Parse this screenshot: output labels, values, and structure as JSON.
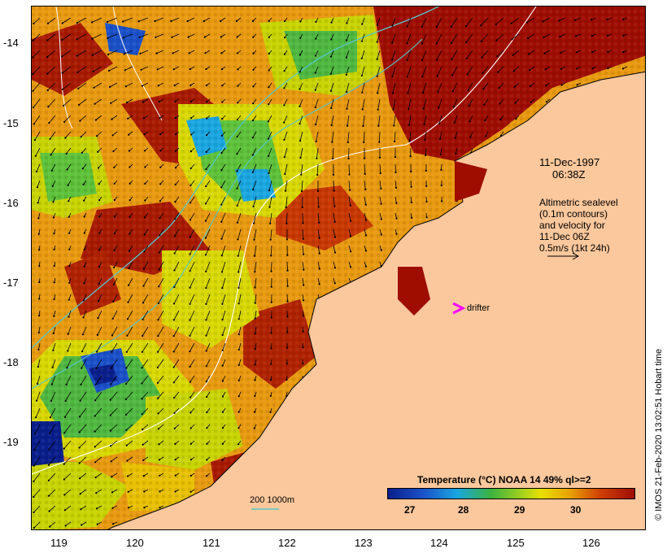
{
  "map": {
    "lon_labels": [
      "119",
      "120",
      "121",
      "122",
      "123",
      "124",
      "125",
      "126"
    ],
    "lat_labels": [
      "-14",
      "-15",
      "-16",
      "-17",
      "-18",
      "-19"
    ],
    "lon_range": [
      118.62,
      126.72
    ],
    "lat_range": [
      -20.07,
      -13.56
    ]
  },
  "annotations": {
    "date_line1": "11-Dec-1997",
    "date_line2": "06:38Z",
    "alt_line1": "Altimetric sealevel",
    "alt_line2": "(0.1m contours)",
    "alt_line3": "and velocity for",
    "alt_line4": "11-Dec 06Z",
    "alt_line5": "0.5m/s (1kt 24h)",
    "drifter_label": "drifter",
    "isobath_label": "200  1000m"
  },
  "colorbar": {
    "title": "Temperature (°C) NOAA 14 49% ql>=2",
    "ticks": [
      "27",
      "28",
      "29",
      "30"
    ]
  },
  "credit": "© IMOS 21-Feb-2020 13:02:51 Hobart time",
  "colors": {
    "land": "#fbc79c",
    "sst_cold": "#0a1e8c",
    "sst_cool": "#1aa6e0",
    "sst_mid": "#3cb33c",
    "sst_warm": "#e8e000",
    "sst_hot": "#e8a000",
    "sst_max": "#9e0d00",
    "drifter": "#ff00ff",
    "isobath": "#55c8c8"
  }
}
